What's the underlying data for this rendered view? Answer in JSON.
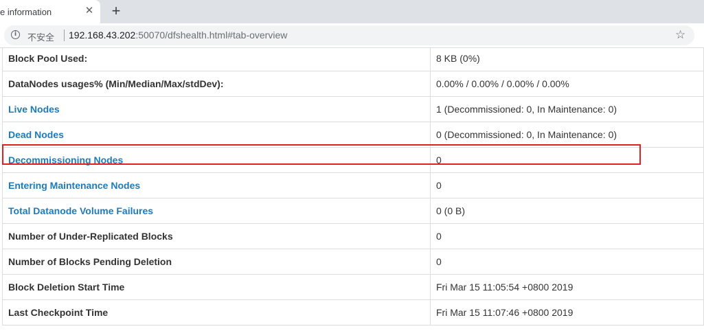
{
  "browser": {
    "tab_title": "e information",
    "close_glyph": "✕",
    "new_tab_glyph": "+",
    "info_glyph": "i",
    "security_label": "不安全",
    "url_host": "192.168.43.202",
    "url_rest": ":50070/dfshealth.html#tab-overview",
    "star_glyph": "☆"
  },
  "rows": [
    {
      "key": "Block Pool Used:",
      "value": "8 KB (0%)",
      "link": false
    },
    {
      "key": "DataNodes usages% (Min/Median/Max/stdDev):",
      "value": "0.00% / 0.00% / 0.00% / 0.00%",
      "link": false
    },
    {
      "key": "Live Nodes",
      "value": "1 (Decommissioned: 0, In Maintenance: 0)",
      "link": true
    },
    {
      "key": "Dead Nodes",
      "value": "0 (Decommissioned: 0, In Maintenance: 0)",
      "link": true
    },
    {
      "key": "Decommissioning Nodes",
      "value": "0",
      "link": true
    },
    {
      "key": "Entering Maintenance Nodes",
      "value": "0",
      "link": true
    },
    {
      "key": "Total Datanode Volume Failures",
      "value": "0 (0 B)",
      "link": true
    },
    {
      "key": "Number of Under-Replicated Blocks",
      "value": "0",
      "link": false
    },
    {
      "key": "Number of Blocks Pending Deletion",
      "value": "0",
      "link": false
    },
    {
      "key": "Block Deletion Start Time",
      "value": "Fri Mar 15 11:05:54 +0800 2019",
      "link": false
    },
    {
      "key": "Last Checkpoint Time",
      "value": "Fri Mar 15 11:07:46 +0800 2019",
      "link": false
    }
  ],
  "colors": {
    "link": "#1b7bbd",
    "highlight": "#e02020"
  }
}
